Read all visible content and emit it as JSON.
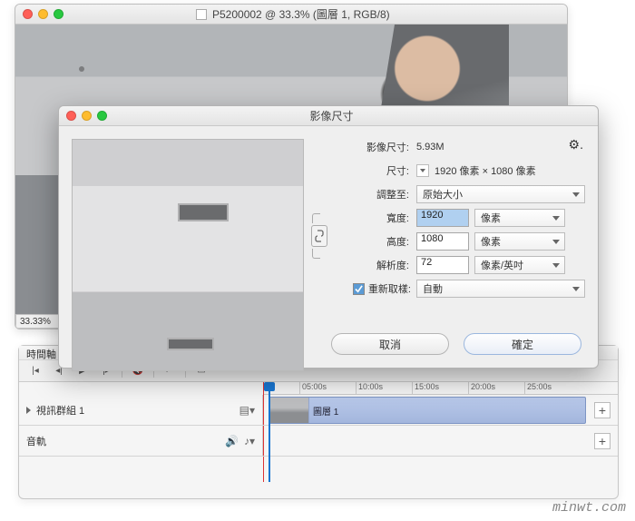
{
  "doc": {
    "title": "P5200002 @ 33.3% (圖層 1, RGB/8)",
    "zoom": "33.33%"
  },
  "dialog": {
    "title": "影像尺寸",
    "size_label": "影像尺寸:",
    "size_value": "5.93M",
    "dim_label": "尺寸:",
    "dim_value": "1920 像素 × 1080 像素",
    "fit_label": "調整至:",
    "fit_value": "原始大小",
    "width_label": "寬度:",
    "width_value": "1920",
    "width_unit": "像素",
    "height_label": "高度:",
    "height_value": "1080",
    "height_unit": "像素",
    "res_label": "解析度:",
    "res_value": "72",
    "res_unit": "像素/英吋",
    "resample_label": "重新取樣:",
    "resample_value": "自動",
    "cancel": "取消",
    "ok": "確定"
  },
  "timeline": {
    "title": "時間軸",
    "ticks": [
      "05:00s",
      "10:00s",
      "15:00s",
      "20:00s",
      "25:00s"
    ],
    "group_label": "視訊群組 1",
    "audio_label": "音軌",
    "clip_label": "圖層 1"
  },
  "watermark": "minwt.com"
}
